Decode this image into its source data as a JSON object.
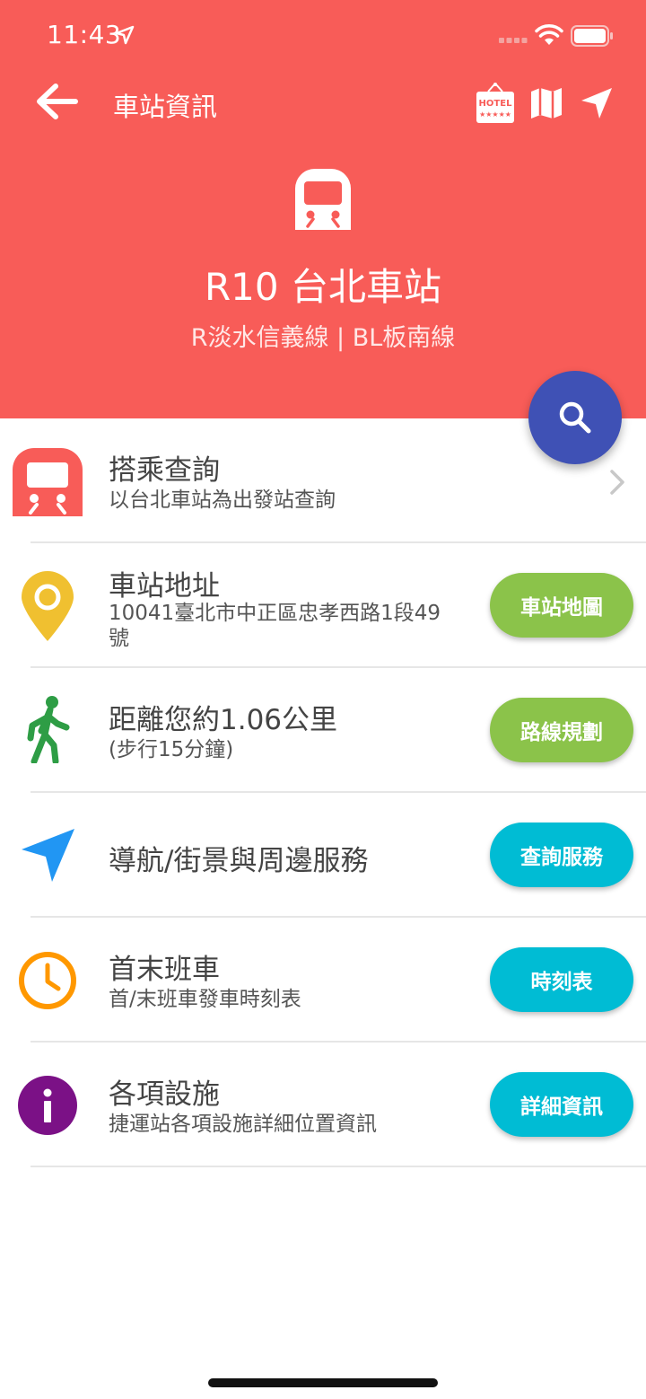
{
  "status": {
    "time": "11:43"
  },
  "nav": {
    "title": "車站資訊"
  },
  "station": {
    "title": "R10 台北車站",
    "lines": "R淡水信義線 | BL板南線"
  },
  "colors": {
    "header": "#f85c58",
    "fab": "#3f51b5",
    "green": "#8bc34a",
    "cyan": "#00bcd4"
  },
  "rows": [
    {
      "title": "搭乘查詢",
      "subtitle": "以台北車站為出發站查詢",
      "icon": "train-icon"
    },
    {
      "title": "車站地址",
      "subtitle": "10041臺北市中正區忠孝西路1段49號",
      "button": "車站地圖",
      "icon": "location-pin-icon"
    },
    {
      "title": "距離您約1.06公里",
      "subtitle": "(步行15分鐘)",
      "button": "路線規劃",
      "icon": "walking-person-icon"
    },
    {
      "title": "導航/街景與周邊服務",
      "button": "查詢服務",
      "icon": "navigation-arrow-icon"
    },
    {
      "title": "首末班車",
      "subtitle": "首/末班車發車時刻表",
      "button": "時刻表",
      "icon": "clock-icon"
    },
    {
      "title": "各項設施",
      "subtitle": "捷運站各項設施詳細位置資訊",
      "button": "詳細資訊",
      "icon": "info-icon"
    }
  ]
}
